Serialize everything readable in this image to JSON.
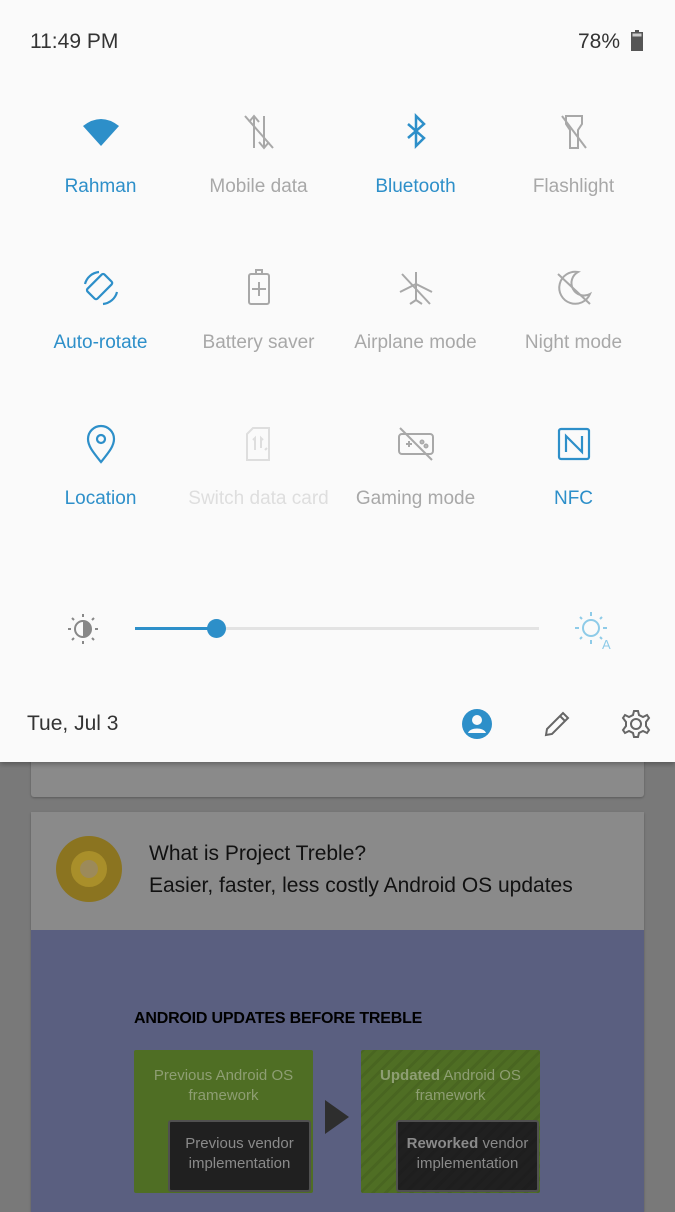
{
  "status_bar": {
    "time": "11:49 PM",
    "battery": "78%"
  },
  "quick_settings": {
    "tiles": [
      {
        "id": "wifi",
        "label": "Rahman",
        "icon": "wifi-icon",
        "state": "on"
      },
      {
        "id": "mobile-data",
        "label": "Mobile data",
        "icon": "mobile-data-off-icon",
        "state": "off"
      },
      {
        "id": "bluetooth",
        "label": "Bluetooth",
        "icon": "bluetooth-icon",
        "state": "on"
      },
      {
        "id": "flashlight",
        "label": "Flashlight",
        "icon": "flashlight-off-icon",
        "state": "off"
      },
      {
        "id": "auto-rotate",
        "label": "Auto-rotate",
        "icon": "auto-rotate-icon",
        "state": "on"
      },
      {
        "id": "battery-saver",
        "label": "Battery saver",
        "icon": "battery-saver-icon",
        "state": "off"
      },
      {
        "id": "airplane-mode",
        "label": "Airplane mode",
        "icon": "airplane-off-icon",
        "state": "off"
      },
      {
        "id": "night-mode",
        "label": "Night mode",
        "icon": "night-mode-off-icon",
        "state": "off"
      },
      {
        "id": "location",
        "label": "Location",
        "icon": "location-pin-icon",
        "state": "on"
      },
      {
        "id": "switch-data-card",
        "label": "Switch data card",
        "icon": "sim-switch-icon",
        "state": "disabled"
      },
      {
        "id": "gaming-mode",
        "label": "Gaming mode",
        "icon": "gamepad-off-icon",
        "state": "off"
      },
      {
        "id": "nfc",
        "label": "NFC",
        "icon": "nfc-icon",
        "state": "on"
      }
    ],
    "brightness": {
      "level": 0.2,
      "low_icon": "brightness-low-icon",
      "auto_icon": "brightness-auto-icon"
    }
  },
  "footer": {
    "date": "Tue, Jul 3",
    "user_icon": "account-circle-icon",
    "edit_icon": "pencil-icon",
    "settings_icon": "gear-icon"
  },
  "background": {
    "article": {
      "title": "What is Project Treble?",
      "subtitle": "Easier, faster, less costly Android OS updates",
      "diagram_title": "ANDROID UPDATES BEFORE TREBLE",
      "left_framework": "Previous Android OS framework",
      "left_vendor": "Previous vendor implementation",
      "right_framework_bold": "Updated",
      "right_framework_rest": " Android OS framework",
      "right_vendor_bold": "Reworked",
      "right_vendor_rest": " vendor implementation"
    }
  },
  "colors": {
    "accent": "#2d8fc9",
    "inactive": "#a8a8a8",
    "disabled": "#dedede",
    "shade_bg": "#fafafa"
  }
}
